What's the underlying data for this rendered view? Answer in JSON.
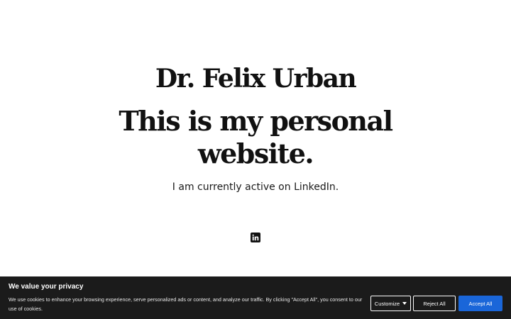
{
  "hero": {
    "name": "Dr. Felix Urban",
    "headline": "This is my personal website.",
    "subtext": "I am currently active on LinkedIn."
  },
  "social": {
    "icon": "linkedin-icon"
  },
  "cookie": {
    "title": "We value your privacy",
    "text": "We use cookies to enhance your browsing experience, serve personalized ads or content, and analyze our traffic. By clicking \"Accept All\", you consent to our use of cookies.",
    "customize_label": "Customize",
    "reject_label": "Reject All",
    "accept_label": "Accept All",
    "accent_color": "#1a66d9",
    "banner_color": "#1b1b1b"
  }
}
